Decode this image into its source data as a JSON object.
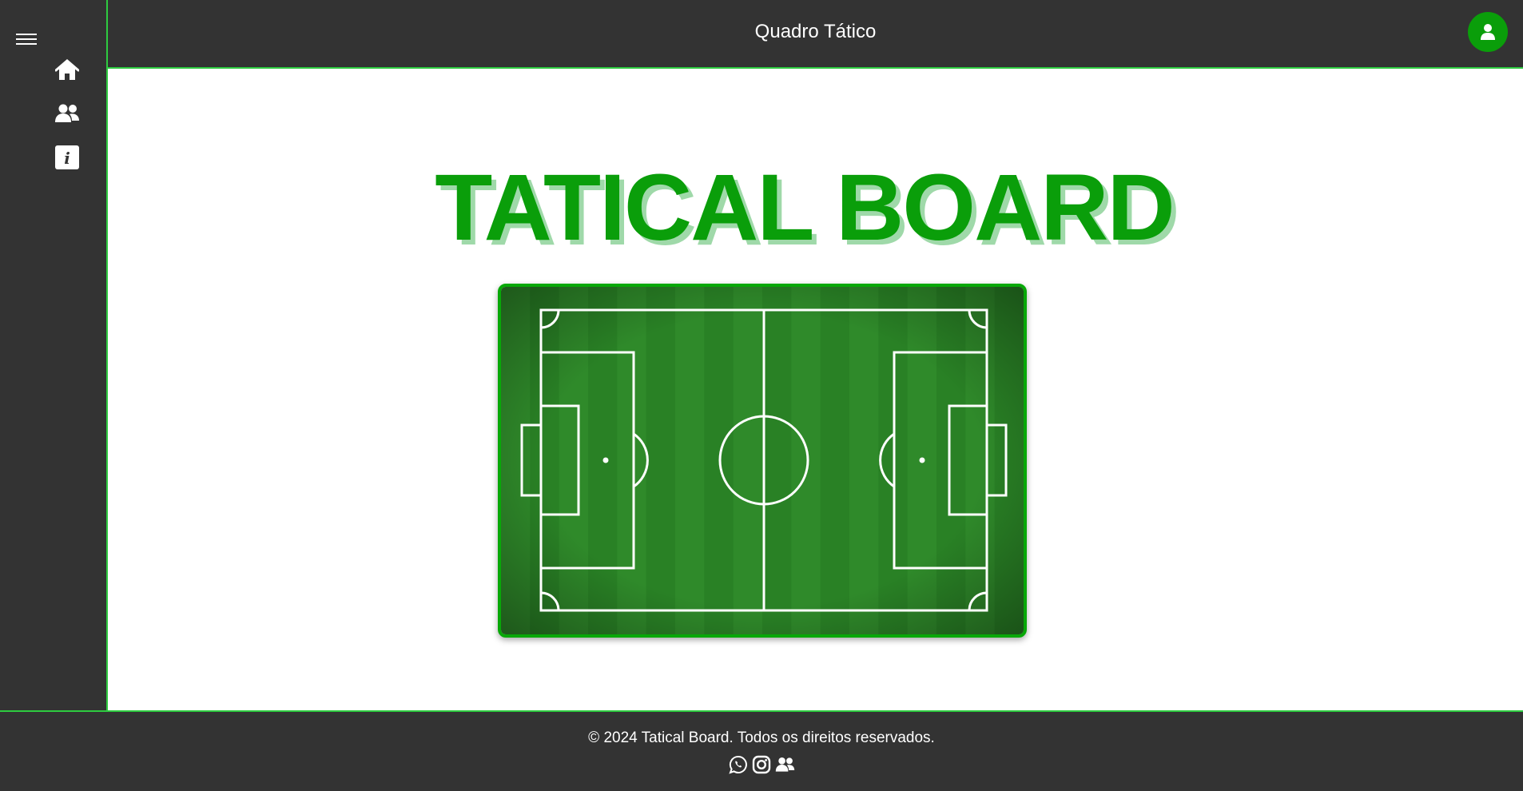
{
  "sidebar": {
    "menu_icon": "hamburger-icon",
    "items": [
      {
        "icon": "home-icon"
      },
      {
        "icon": "users-icon"
      },
      {
        "icon": "info-icon"
      }
    ]
  },
  "header": {
    "title": "Quadro Tático",
    "avatar_icon": "user-icon"
  },
  "main": {
    "title": "TATICAL BOARD",
    "board_icon": "soccer-pitch"
  },
  "footer": {
    "copyright": "© 2024 Tatical Board. Todos os direitos reservados.",
    "icons": [
      "whatsapp-icon",
      "instagram-icon",
      "users-icon"
    ]
  },
  "colors": {
    "accent": "#2ecc40",
    "brand_green": "#0a9e0a",
    "dark": "#333333"
  }
}
